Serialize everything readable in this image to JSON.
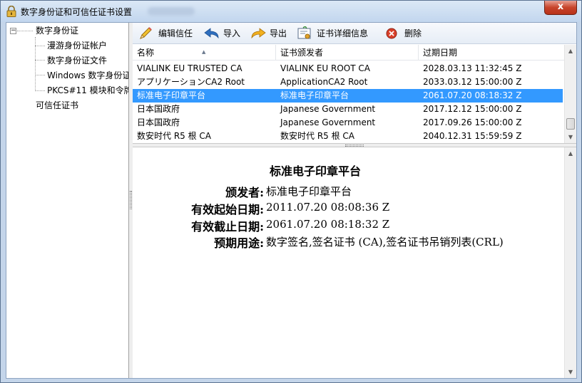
{
  "window": {
    "title": "数字身份证和可信任证书设置",
    "close_label": "x"
  },
  "tree": {
    "root": {
      "label": "数字身份证",
      "expander": "−"
    },
    "children": [
      {
        "label": "漫游身份证帐户"
      },
      {
        "label": "数字身份证文件"
      },
      {
        "label": "Windows 数字身份证"
      },
      {
        "label": "PKCS#11 模块和令牌"
      }
    ],
    "trusted": {
      "label": "可信任证书"
    }
  },
  "toolbar": {
    "edit_label": "编辑信任",
    "import_label": "导入",
    "export_label": "导出",
    "details_label": "证书详细信息",
    "delete_label": "删除",
    "delete_icon_color": "#d9402b"
  },
  "table": {
    "columns": [
      {
        "label": "名称"
      },
      {
        "label": "证书颁发者"
      },
      {
        "label": "过期日期"
      }
    ],
    "rows": [
      {
        "name": "VIALINK EU TRUSTED CA",
        "issuer": "VIALINK EU ROOT CA",
        "expires": "2028.03.13 11:32:45 Z"
      },
      {
        "name": "アプリケーションCA2 Root",
        "issuer": "ApplicationCA2 Root",
        "expires": "2033.03.12 15:00:00 Z"
      },
      {
        "name": "标准电子印章平台",
        "issuer": "标准电子印章平台",
        "expires": "2061.07.20 08:18:32 Z",
        "selected": true
      },
      {
        "name": "日本国政府",
        "issuer": "Japanese Government",
        "expires": "2017.12.12 15:00:00 Z"
      },
      {
        "name": "日本国政府",
        "issuer": "Japanese Government",
        "expires": "2017.09.26 15:00:00 Z"
      },
      {
        "name": "数安时代 R5 根 CA",
        "issuer": "数安时代 R5 根 CA",
        "expires": "2040.12.31 15:59:59 Z"
      }
    ],
    "selection_color": "#3399ff"
  },
  "detail": {
    "title": "标准电子印章平台",
    "fields": [
      {
        "label": "颁发者:",
        "value": "标准电子印章平台"
      },
      {
        "label": "有效起始日期:",
        "value": "2011.07.20 08:08:36 Z"
      },
      {
        "label": "有效截止日期:",
        "value": "2061.07.20 08:18:32 Z"
      },
      {
        "label": "预期用途:",
        "value": "数字签名,签名证书 (CA),签名证书吊销列表(CRL)"
      }
    ]
  }
}
